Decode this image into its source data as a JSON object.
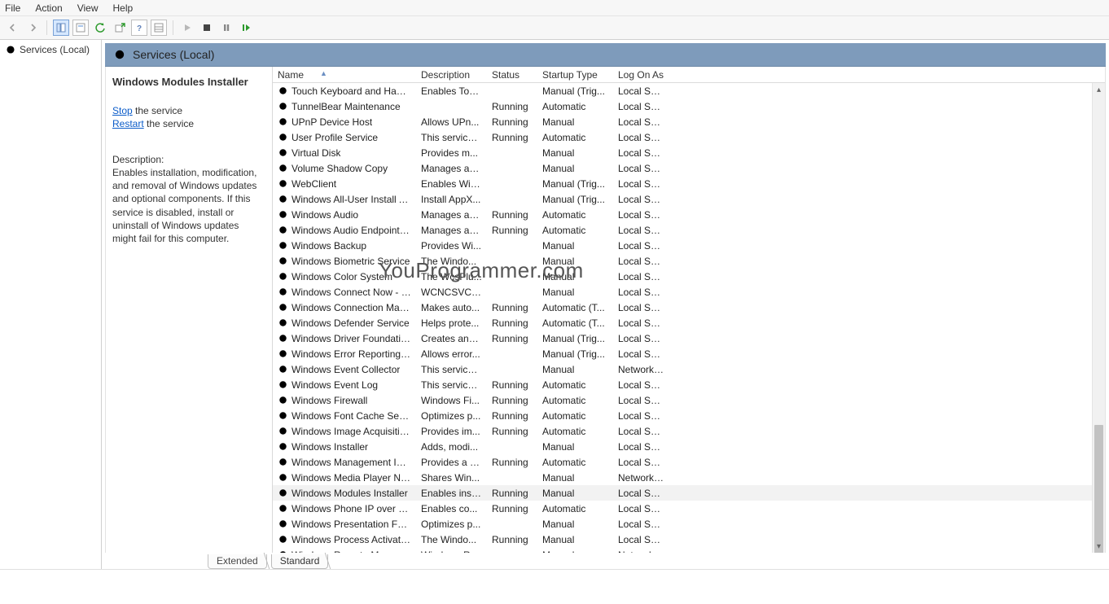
{
  "menu": {
    "file": "File",
    "action": "Action",
    "view": "View",
    "help": "Help"
  },
  "nav": {
    "root": "Services (Local)"
  },
  "content_header": "Services (Local)",
  "detail": {
    "selected_name": "Windows Modules Installer",
    "stop_link": "Stop",
    "stop_suffix": " the service",
    "restart_link": "Restart",
    "restart_suffix": " the service",
    "desc_label": "Description:",
    "desc_body": "Enables installation, modification, and removal of Windows updates and optional components. If this service is disabled, install or uninstall of Windows updates might fail for this computer."
  },
  "columns": {
    "name": "Name",
    "description": "Description",
    "status": "Status",
    "startup": "Startup Type",
    "logon": "Log On As"
  },
  "tabs": {
    "extended": "Extended",
    "standard": "Standard"
  },
  "watermark": "YouProgrammer.com",
  "services": [
    {
      "name": "Touch Keyboard and Hand...",
      "desc": "Enables Tou...",
      "status": "",
      "startup": "Manual (Trig...",
      "logon": "Local Syste..."
    },
    {
      "name": "TunnelBear Maintenance",
      "desc": "",
      "status": "Running",
      "startup": "Automatic",
      "logon": "Local Syste..."
    },
    {
      "name": "UPnP Device Host",
      "desc": "Allows UPn...",
      "status": "Running",
      "startup": "Manual",
      "logon": "Local Service"
    },
    {
      "name": "User Profile Service",
      "desc": "This service ...",
      "status": "Running",
      "startup": "Automatic",
      "logon": "Local Syste..."
    },
    {
      "name": "Virtual Disk",
      "desc": "Provides m...",
      "status": "",
      "startup": "Manual",
      "logon": "Local Syste..."
    },
    {
      "name": "Volume Shadow Copy",
      "desc": "Manages an...",
      "status": "",
      "startup": "Manual",
      "logon": "Local Syste..."
    },
    {
      "name": "WebClient",
      "desc": "Enables Win...",
      "status": "",
      "startup": "Manual (Trig...",
      "logon": "Local Service"
    },
    {
      "name": "Windows All-User Install Ag...",
      "desc": "Install AppX...",
      "status": "",
      "startup": "Manual (Trig...",
      "logon": "Local Syste..."
    },
    {
      "name": "Windows Audio",
      "desc": "Manages au...",
      "status": "Running",
      "startup": "Automatic",
      "logon": "Local Service"
    },
    {
      "name": "Windows Audio Endpoint B...",
      "desc": "Manages au...",
      "status": "Running",
      "startup": "Automatic",
      "logon": "Local Syste..."
    },
    {
      "name": "Windows Backup",
      "desc": "Provides Wi...",
      "status": "",
      "startup": "Manual",
      "logon": "Local Syste..."
    },
    {
      "name": "Windows Biometric Service",
      "desc": "The Windo...",
      "status": "",
      "startup": "Manual",
      "logon": "Local Syste..."
    },
    {
      "name": "Windows Color System",
      "desc": "The WcsPlu...",
      "status": "",
      "startup": "Manual",
      "logon": "Local Service"
    },
    {
      "name": "Windows Connect Now - C...",
      "desc": "WCNCSVC ...",
      "status": "",
      "startup": "Manual",
      "logon": "Local Service"
    },
    {
      "name": "Windows Connection Mana...",
      "desc": "Makes auto...",
      "status": "Running",
      "startup": "Automatic (T...",
      "logon": "Local Service"
    },
    {
      "name": "Windows Defender Service",
      "desc": "Helps prote...",
      "status": "Running",
      "startup": "Automatic (T...",
      "logon": "Local Syste..."
    },
    {
      "name": "Windows Driver Foundation...",
      "desc": "Creates and...",
      "status": "Running",
      "startup": "Manual (Trig...",
      "logon": "Local Syste..."
    },
    {
      "name": "Windows Error Reporting Se...",
      "desc": "Allows error...",
      "status": "",
      "startup": "Manual (Trig...",
      "logon": "Local Syste..."
    },
    {
      "name": "Windows Event Collector",
      "desc": "This service ...",
      "status": "",
      "startup": "Manual",
      "logon": "Network S..."
    },
    {
      "name": "Windows Event Log",
      "desc": "This service ...",
      "status": "Running",
      "startup": "Automatic",
      "logon": "Local Service"
    },
    {
      "name": "Windows Firewall",
      "desc": "Windows Fi...",
      "status": "Running",
      "startup": "Automatic",
      "logon": "Local Service"
    },
    {
      "name": "Windows Font Cache Service",
      "desc": "Optimizes p...",
      "status": "Running",
      "startup": "Automatic",
      "logon": "Local Service"
    },
    {
      "name": "Windows Image Acquisitio...",
      "desc": "Provides im...",
      "status": "Running",
      "startup": "Automatic",
      "logon": "Local Service"
    },
    {
      "name": "Windows Installer",
      "desc": "Adds, modi...",
      "status": "",
      "startup": "Manual",
      "logon": "Local Syste..."
    },
    {
      "name": "Windows Management Inst...",
      "desc": "Provides a c...",
      "status": "Running",
      "startup": "Automatic",
      "logon": "Local Syste..."
    },
    {
      "name": "Windows Media Player Net...",
      "desc": "Shares Win...",
      "status": "",
      "startup": "Manual",
      "logon": "Network S..."
    },
    {
      "name": "Windows Modules Installer",
      "desc": "Enables inst...",
      "status": "Running",
      "startup": "Manual",
      "logon": "Local Syste...",
      "selected": true
    },
    {
      "name": "Windows Phone IP over US...",
      "desc": "Enables co...",
      "status": "Running",
      "startup": "Automatic",
      "logon": "Local Syste..."
    },
    {
      "name": "Windows Presentation Fou...",
      "desc": "Optimizes p...",
      "status": "",
      "startup": "Manual",
      "logon": "Local Service"
    },
    {
      "name": "Windows Process Activatio...",
      "desc": "The Windo...",
      "status": "Running",
      "startup": "Manual",
      "logon": "Local Syste..."
    },
    {
      "name": "Windows Remote Manage...",
      "desc": "Windows R...",
      "status": "",
      "startup": "Manual",
      "logon": "Network S..."
    }
  ]
}
